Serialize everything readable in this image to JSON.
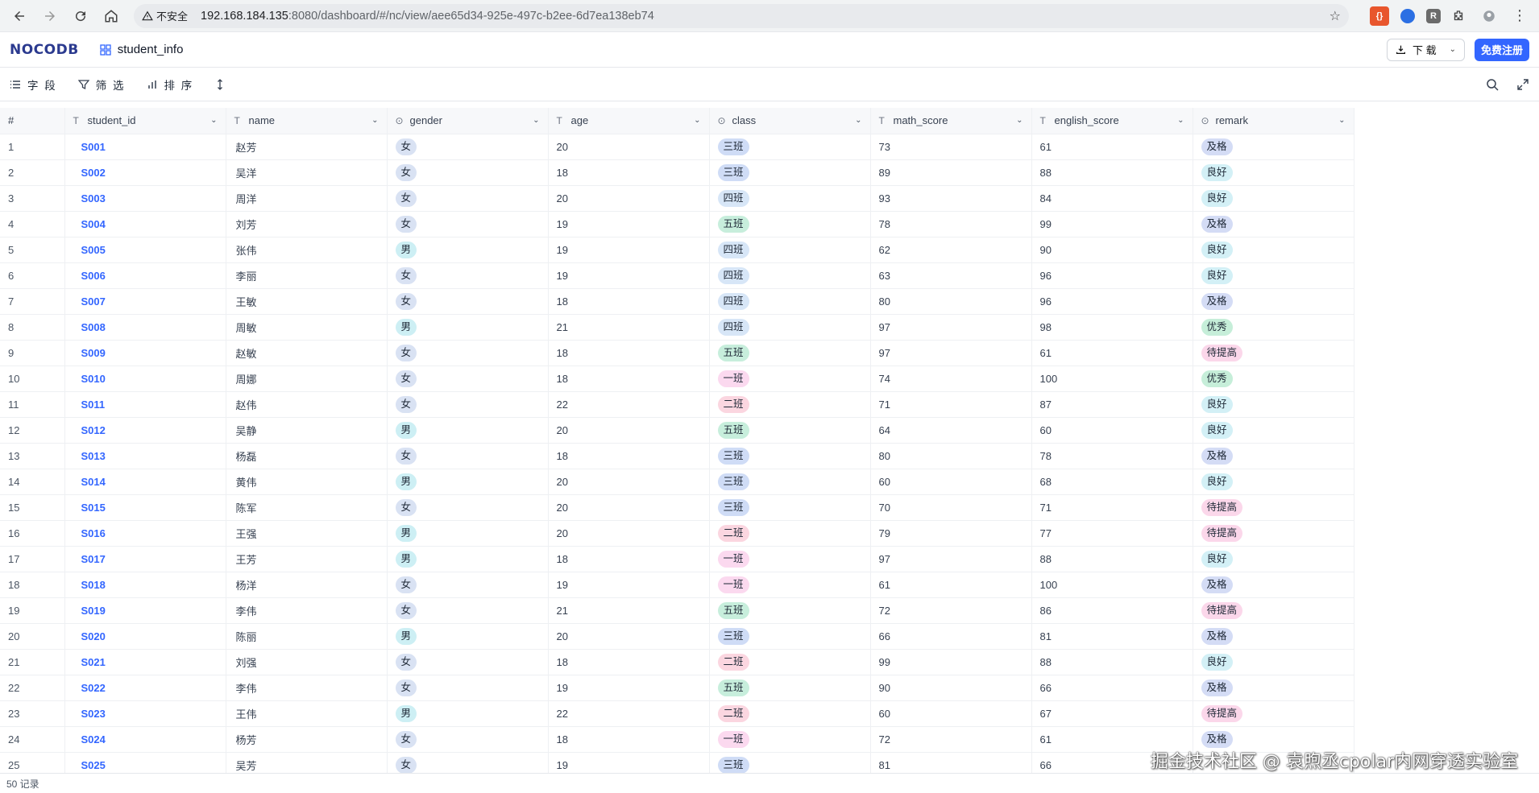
{
  "browser": {
    "insecure_label": "不安全",
    "url_host": "192.168.184.135",
    "url_path": ":8080/dashboard/#/nc/view/aee65d34-925e-497c-b2ee-6d7ea138eb74"
  },
  "app": {
    "logo": "NOCODB",
    "table_name": "student_info",
    "download_label": "下 载",
    "signup_label": "免费注册"
  },
  "toolbar": {
    "fields_label": "字 段",
    "filter_label": "筛 选",
    "sort_label": "排 序"
  },
  "grid": {
    "row_header": "#",
    "columns": [
      {
        "name": "student_id",
        "type_icon": "T"
      },
      {
        "name": "name",
        "type_icon": "T"
      },
      {
        "name": "gender",
        "type_icon": "select"
      },
      {
        "name": "age",
        "type_icon": "T"
      },
      {
        "name": "class",
        "type_icon": "select"
      },
      {
        "name": "math_score",
        "type_icon": "T"
      },
      {
        "name": "english_score",
        "type_icon": "T"
      },
      {
        "name": "remark",
        "type_icon": "select"
      }
    ],
    "rows": [
      [
        "1",
        "S001",
        "赵芳",
        "女",
        "20",
        "三班",
        "73",
        "61",
        "及格"
      ],
      [
        "2",
        "S002",
        "吴洋",
        "女",
        "18",
        "三班",
        "89",
        "88",
        "良好"
      ],
      [
        "3",
        "S003",
        "周洋",
        "女",
        "20",
        "四班",
        "93",
        "84",
        "良好"
      ],
      [
        "4",
        "S004",
        "刘芳",
        "女",
        "19",
        "五班",
        "78",
        "99",
        "及格"
      ],
      [
        "5",
        "S005",
        "张伟",
        "男",
        "19",
        "四班",
        "62",
        "90",
        "良好"
      ],
      [
        "6",
        "S006",
        "李丽",
        "女",
        "19",
        "四班",
        "63",
        "96",
        "良好"
      ],
      [
        "7",
        "S007",
        "王敏",
        "女",
        "18",
        "四班",
        "80",
        "96",
        "及格"
      ],
      [
        "8",
        "S008",
        "周敏",
        "男",
        "21",
        "四班",
        "97",
        "98",
        "优秀"
      ],
      [
        "9",
        "S009",
        "赵敏",
        "女",
        "18",
        "五班",
        "97",
        "61",
        "待提高"
      ],
      [
        "10",
        "S010",
        "周娜",
        "女",
        "18",
        "一班",
        "74",
        "100",
        "优秀"
      ],
      [
        "11",
        "S011",
        "赵伟",
        "女",
        "22",
        "二班",
        "71",
        "87",
        "良好"
      ],
      [
        "12",
        "S012",
        "吴静",
        "男",
        "20",
        "五班",
        "64",
        "60",
        "良好"
      ],
      [
        "13",
        "S013",
        "杨磊",
        "女",
        "18",
        "三班",
        "80",
        "78",
        "及格"
      ],
      [
        "14",
        "S014",
        "黄伟",
        "男",
        "20",
        "三班",
        "60",
        "68",
        "良好"
      ],
      [
        "15",
        "S015",
        "陈军",
        "女",
        "20",
        "三班",
        "70",
        "71",
        "待提高"
      ],
      [
        "16",
        "S016",
        "王强",
        "男",
        "20",
        "二班",
        "79",
        "77",
        "待提高"
      ],
      [
        "17",
        "S017",
        "王芳",
        "男",
        "18",
        "一班",
        "97",
        "88",
        "良好"
      ],
      [
        "18",
        "S018",
        "杨洋",
        "女",
        "19",
        "一班",
        "61",
        "100",
        "及格"
      ],
      [
        "19",
        "S019",
        "李伟",
        "女",
        "21",
        "五班",
        "72",
        "86",
        "待提高"
      ],
      [
        "20",
        "S020",
        "陈丽",
        "男",
        "20",
        "三班",
        "66",
        "81",
        "及格"
      ],
      [
        "21",
        "S021",
        "刘强",
        "女",
        "18",
        "二班",
        "99",
        "88",
        "良好"
      ],
      [
        "22",
        "S022",
        "李伟",
        "女",
        "19",
        "五班",
        "90",
        "66",
        "及格"
      ],
      [
        "23",
        "S023",
        "王伟",
        "男",
        "22",
        "二班",
        "60",
        "67",
        "待提高"
      ],
      [
        "24",
        "S024",
        "杨芳",
        "女",
        "18",
        "一班",
        "72",
        "61",
        "及格"
      ],
      [
        "25",
        "S025",
        "吴芳",
        "女",
        "19",
        "三班",
        "81",
        "66",
        ""
      ]
    ]
  },
  "footer": {
    "record_count": "50 记录"
  },
  "watermark": "掘金技术社区 @ 袁煦丞cpolar内网穿透实验室",
  "colors": {
    "accent": "#3366ff",
    "logo": "#2b3a8f"
  }
}
